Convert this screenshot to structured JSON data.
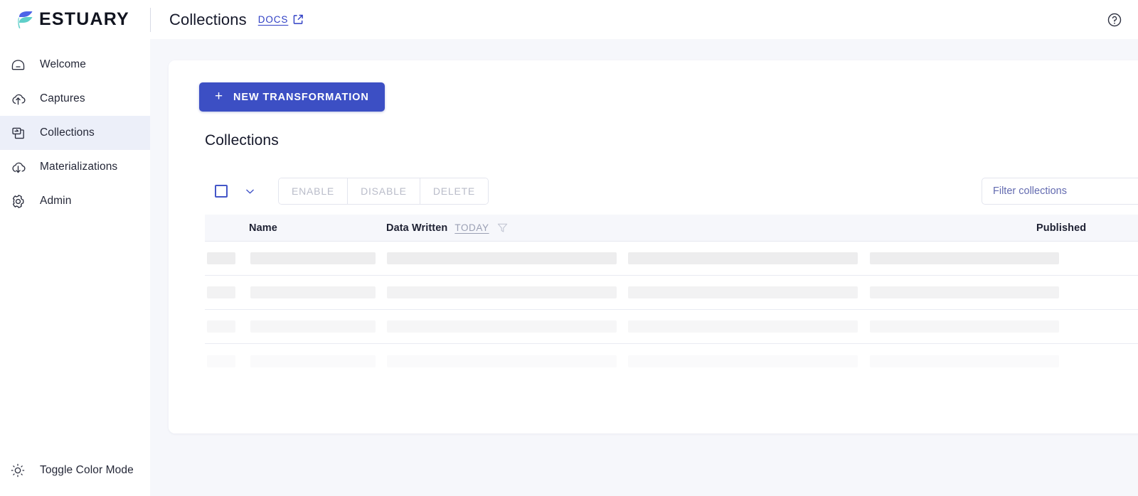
{
  "colors": {
    "accent": "#3c4fc4",
    "link": "#2e3ec4",
    "sidebar_active_bg": "#eceff9",
    "page_bg": "#f6f7fb",
    "card_bg": "#ffffff",
    "logo_blue": "#4d63e8",
    "logo_teal": "#5fcfc9",
    "muted_text": "#b9bcc9",
    "placeholder": "#636bb0"
  },
  "topbar": {
    "brand_name": "ESTUARY",
    "brand_icon": "estuary-wave-logo",
    "page_title": "Collections",
    "docs_label": "DOCS",
    "docs_icon": "external-link-icon",
    "help_icon": "help-circle-icon"
  },
  "sidebar": {
    "items": [
      {
        "label": "Welcome",
        "icon": "home-icon",
        "active": false
      },
      {
        "label": "Captures",
        "icon": "cloud-upload-icon",
        "active": false
      },
      {
        "label": "Collections",
        "icon": "collections-icon",
        "active": true
      },
      {
        "label": "Materializations",
        "icon": "cloud-download-icon",
        "active": false
      },
      {
        "label": "Admin",
        "icon": "gear-icon",
        "active": false
      }
    ],
    "footer": {
      "label": "Toggle Color Mode",
      "icon": "sun-icon"
    }
  },
  "main": {
    "new_transformation_label": "NEW TRANSFORMATION",
    "new_transformation_icon": "plus-icon",
    "section_heading": "Collections",
    "toolbar": {
      "select_all_icon": "checkbox-unchecked-icon",
      "select_menu_icon": "chevron-down-icon",
      "enable_label": "ENABLE",
      "disable_label": "DISABLE",
      "delete_label": "DELETE",
      "filter_placeholder": "Filter collections",
      "filter_value": ""
    },
    "table": {
      "columns": [
        "",
        "Name",
        "Data Written",
        "",
        "Published"
      ],
      "data_written_filter_label": "TODAY",
      "data_written_filter_icon": "funnel-icon",
      "skeleton_rows": [
        {
          "opacity": 1.0
        },
        {
          "opacity": 0.72
        },
        {
          "opacity": 0.46
        },
        {
          "opacity": 0.2
        }
      ],
      "rows": []
    }
  }
}
